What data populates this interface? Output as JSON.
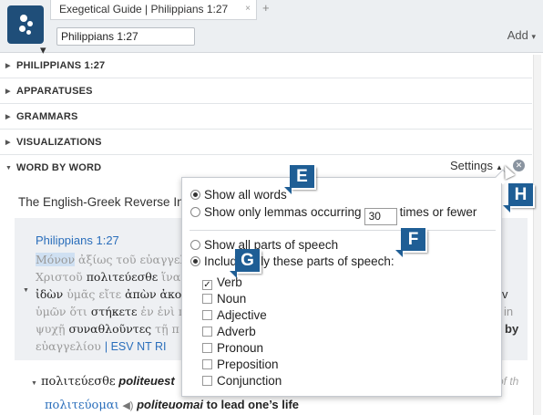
{
  "window": {
    "tab_title": "Exegetical Guide | Philippians 1:27",
    "tab_close": "×",
    "new_tab": "+",
    "reference_input": "Philippians 1:27",
    "add_menu": "Add",
    "logo_icon": "logos-logo-icon"
  },
  "sections": [
    {
      "label": "PHILIPPIANS 1:27"
    },
    {
      "label": "APPARATUSES"
    },
    {
      "label": "GRAMMARS"
    },
    {
      "label": "VISUALIZATIONS"
    },
    {
      "label": "WORD BY WORD"
    }
  ],
  "settings": {
    "label": "Settings"
  },
  "wordbyword": {
    "subtitle": "The English-Greek Reverse In",
    "passage_ref": "Philippians 1:27",
    "line1_a": "Μόνον",
    "line1_b": " ἀξίως τοῦ εὐαγγελ",
    "line2_a": "Χριστοῦ ",
    "line2_b": "πολιτεύεσθε",
    "line2_c": " ἵνα",
    "line3_a": "ἰδὼν ",
    "line3_b": "ὑμᾶς εἴτε ",
    "line3_c": "ἀπὼν ἀκο",
    "line4": "ὑμῶν ὅτι ",
    "line4_b": "στήκετε",
    "line4_c": " ἐν ἑνὶ π",
    "line5_a": "ψυχῇ ",
    "line5_b": "συναθλοῦντες",
    "line5_c": " τῇ π",
    "line6_a": "εὐαγγελίου",
    "line6_b": "| ESV NT RI",
    "right_v": "v",
    "right_in": "in",
    "right_by": "by",
    "word_greek": "πολιτεύεσθε",
    "word_translit": "politeuest",
    "of_the": "of th",
    "lemma_greek": "πολιτεύομαι",
    "lemma_translit": "politeuomai",
    "lemma_gloss": "to lead one’s life"
  },
  "popup": {
    "show_all_words": "Show all words",
    "show_only_lemmas": "Show only lemmas occurring",
    "times_value": "30",
    "times_or_fewer": "times or fewer",
    "show_all_pos": "Show all parts of speech",
    "include_only_pos": "Include only these parts of speech:",
    "selected_word_option": "show_all_words",
    "selected_pos_option": "include_only",
    "parts_of_speech": [
      {
        "label": "Verb",
        "checked": true
      },
      {
        "label": "Noun",
        "checked": false
      },
      {
        "label": "Adjective",
        "checked": false
      },
      {
        "label": "Adverb",
        "checked": false
      },
      {
        "label": "Pronoun",
        "checked": false
      },
      {
        "label": "Preposition",
        "checked": false
      },
      {
        "label": "Conjunction",
        "checked": false
      }
    ]
  },
  "callouts": [
    "E",
    "F",
    "G",
    "H"
  ],
  "colors": {
    "accent": "#1f5e95",
    "link": "#2a6ebb"
  }
}
